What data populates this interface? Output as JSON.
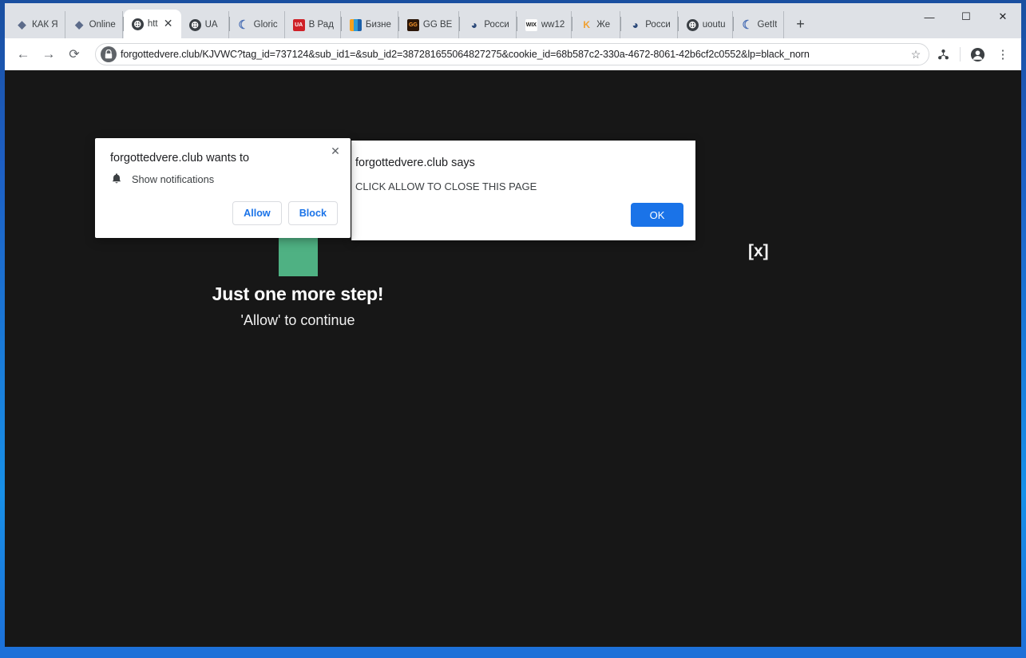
{
  "browser": {
    "tabs": [
      {
        "title": "КАК Я",
        "icon": "dot-icon",
        "favicon_class": "dot",
        "favicon_text": "◆",
        "active": false
      },
      {
        "title": "Online",
        "icon": "dot-icon",
        "favicon_class": "dot",
        "favicon_text": "◆",
        "active": false
      },
      {
        "title": "htt",
        "icon": "globe-icon",
        "favicon_class": "globe",
        "favicon_text": "⊕",
        "active": true
      },
      {
        "title": "UA",
        "icon": "globe-icon",
        "favicon_class": "globe",
        "favicon_text": "⊕",
        "active": false
      },
      {
        "title": "Gloric",
        "icon": "moon-icon",
        "favicon_class": "moon",
        "favicon_text": "☾",
        "active": false
      },
      {
        "title": "В Рад",
        "icon": "ua-flag-icon",
        "favicon_class": "ua",
        "favicon_text": "UA",
        "active": false
      },
      {
        "title": "Бизне",
        "icon": "bar-chart-icon",
        "favicon_class": "chart",
        "favicon_text": "",
        "active": false
      },
      {
        "title": "GG BE",
        "icon": "gg-logo-icon",
        "favicon_class": "gg",
        "favicon_text": "GG",
        "active": false
      },
      {
        "title": "Росси",
        "icon": "shell-icon",
        "favicon_class": "shell",
        "favicon_text": "◕",
        "active": false
      },
      {
        "title": "ww12",
        "icon": "wix-logo-icon",
        "favicon_class": "wix",
        "favicon_text": "WIX",
        "active": false
      },
      {
        "title": "Же",
        "icon": "telegram-icon",
        "favicon_class": "k",
        "favicon_text": "K",
        "active": false
      },
      {
        "title": "Росси",
        "icon": "shell-icon",
        "favicon_class": "shell",
        "favicon_text": "◕",
        "active": false
      },
      {
        "title": "uoutu",
        "icon": "globe-icon",
        "favicon_class": "globe",
        "favicon_text": "⊕",
        "active": false
      },
      {
        "title": "GetIt",
        "icon": "moon-icon",
        "favicon_class": "moon",
        "favicon_text": "☾",
        "active": false
      }
    ],
    "tab_close_glyph": "✕",
    "new_tab_label": "+",
    "window_controls": {
      "minimize": "—",
      "maximize": "☐",
      "close": "✕"
    },
    "toolbar": {
      "back": "←",
      "forward": "→",
      "reload": "⟳",
      "url": "forgottedvere.club/KJVWC?tag_id=737124&sub_id1=&sub_id2=387281655064827275&cookie_id=68b587c2-330a-4672-8061-42b6cf2c0552&lp=black_norn",
      "star": "☆",
      "extension": "⚛",
      "profile": "●",
      "menu": "⋮"
    }
  },
  "perm_bubble": {
    "title": "forgottedvere.club wants to",
    "permission_label": "Show notifications",
    "allow_label": "Allow",
    "block_label": "Block",
    "close_glyph": "✕"
  },
  "js_alert": {
    "title": "forgottedvere.club says",
    "message": "CLICK ALLOW TO CLOSE THIS PAGE",
    "ok_label": "OK"
  },
  "page": {
    "headline": "Just one more step!",
    "subline": "'Allow' to continue",
    "close_marker": "[x]",
    "background_color": "#171717",
    "arrow_color": "#4fb183"
  }
}
